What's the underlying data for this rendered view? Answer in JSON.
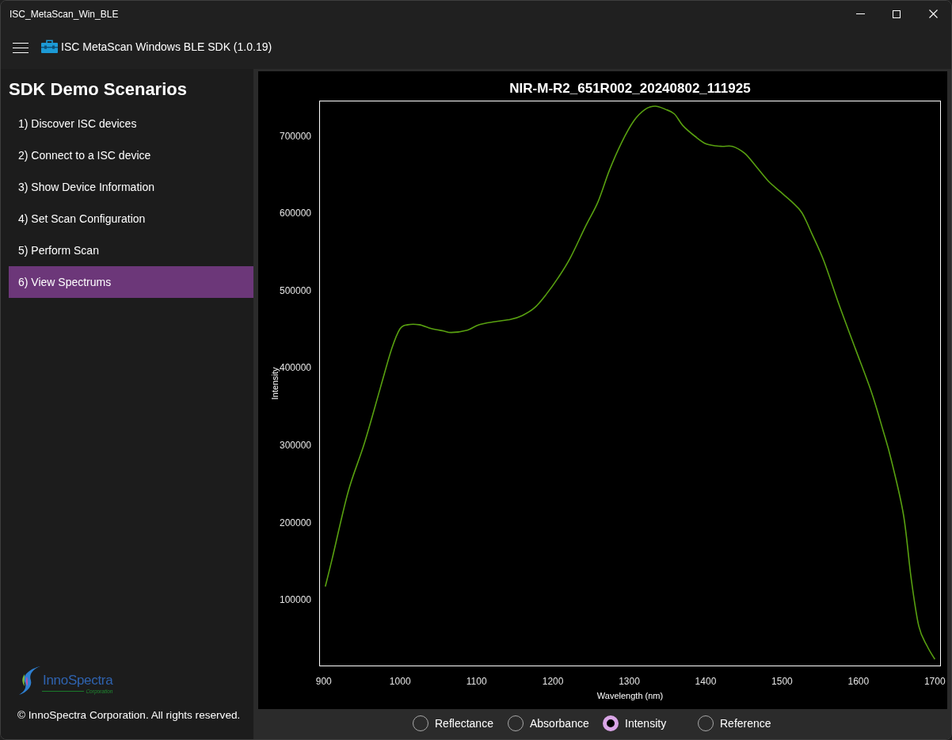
{
  "window": {
    "title": "ISC_MetaScan_Win_BLE"
  },
  "header": {
    "title": "ISC MetaScan Windows BLE SDK (1.0.19)"
  },
  "sidebar": {
    "title": "SDK Demo Scenarios",
    "items": [
      {
        "label": "1) Discover ISC devices",
        "selected": false
      },
      {
        "label": "2) Connect to a ISC device",
        "selected": false
      },
      {
        "label": "3) Show Device Information",
        "selected": false
      },
      {
        "label": "4) Set Scan Configuration",
        "selected": false
      },
      {
        "label": "5) Perform Scan",
        "selected": false
      },
      {
        "label": "6) View Spectrums",
        "selected": true
      }
    ],
    "logo": {
      "wordmark": "InnoSpectra",
      "tagline": "Corporation"
    },
    "copyright": "© InnoSpectra Corporation. All rights reserved."
  },
  "chart": {
    "chart_data": {
      "type": "line",
      "title": "NIR-M-R2_651R002_20240802_111925",
      "xlabel": "Wavelength (nm)",
      "ylabel": "Intensity",
      "x": [
        902,
        911,
        932,
        953,
        974,
        989,
        1000,
        1010,
        1025,
        1041,
        1057,
        1067,
        1088,
        1103,
        1124,
        1145,
        1160,
        1176,
        1191,
        1207,
        1223,
        1243,
        1259,
        1274,
        1290,
        1306,
        1321,
        1334,
        1347,
        1359,
        1370,
        1386,
        1401,
        1420,
        1435,
        1451,
        1466,
        1482,
        1498,
        1513,
        1526,
        1539,
        1555,
        1575,
        1596,
        1617,
        1632,
        1643,
        1659,
        1669,
        1679,
        1690,
        1700
      ],
      "series": [
        {
          "color": "#58a010",
          "values": [
            117000,
            153000,
            240000,
            302000,
            374000,
            425000,
            451000,
            456000,
            456000,
            451000,
            448000,
            446000,
            449000,
            456000,
            460000,
            463000,
            468000,
            478000,
            495000,
            517000,
            543000,
            584000,
            615000,
            656000,
            692000,
            720000,
            735000,
            739000,
            735000,
            729000,
            714000,
            700000,
            690000,
            687000,
            687000,
            678000,
            661000,
            642000,
            628000,
            615000,
            601000,
            574000,
            538000,
            481000,
            425000,
            369000,
            320000,
            281000,
            210000,
            128000,
            66000,
            40000,
            23000
          ]
        }
      ],
      "xlim": [
        894,
        1708
      ],
      "ylim": [
        13850,
        746150
      ],
      "xticks": [
        900,
        1000,
        1100,
        1200,
        1300,
        1400,
        1500,
        1600,
        1700
      ],
      "yticks": [
        100000,
        200000,
        300000,
        400000,
        500000,
        600000,
        700000
      ]
    }
  },
  "view_modes": [
    {
      "label": "Reflectance",
      "selected": false
    },
    {
      "label": "Absorbance",
      "selected": false
    },
    {
      "label": "Intensity",
      "selected": true
    },
    {
      "label": "Reference",
      "selected": false
    }
  ]
}
